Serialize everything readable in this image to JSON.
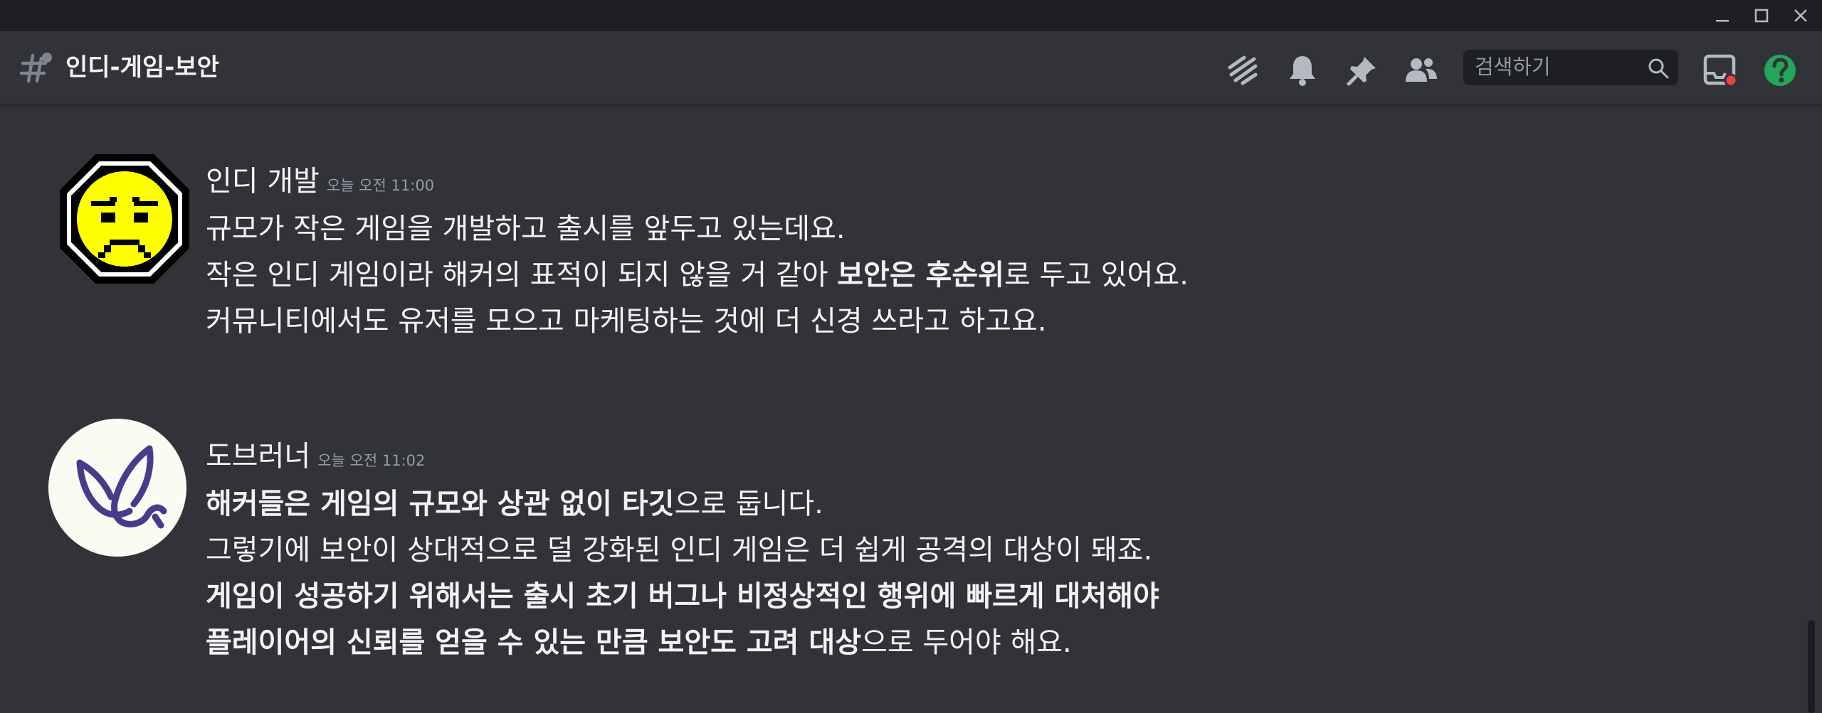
{
  "channel": {
    "name": "인디-게임-보안"
  },
  "search": {
    "placeholder": "검색하기"
  },
  "icons": {
    "hash": "hash-with-thread-icon",
    "threads": "threads-icon",
    "notifications": "bell-icon",
    "pins": "pin-icon",
    "members": "members-icon",
    "search": "search-icon",
    "inbox": "inbox-icon",
    "help": "help-icon"
  },
  "colors": {
    "background": "#313338",
    "titlebar": "#1e1f22",
    "help_green": "#23a55a",
    "inbox_badge": "#f23f43",
    "avatar1_yellow": "#ffff00",
    "avatar2_purple": "#4a3a8c"
  },
  "messages": [
    {
      "author": "인디 개발",
      "timestamp": "오늘 오전 11:00",
      "lines": [
        [
          {
            "text": "규모가 작은 게임을 개발하고 출시를 앞두고 있는데요.",
            "bold": false
          }
        ],
        [
          {
            "text": "작은 인디 게임이라 해커의 표적이 되지 않을 거 같아 ",
            "bold": false
          },
          {
            "text": "보안은 후순위",
            "bold": true
          },
          {
            "text": "로 두고 있어요.",
            "bold": false
          }
        ],
        [
          {
            "text": "커뮤니티에서도 유저를 모으고 마케팅하는 것에 더 신경 쓰라고 하고요.",
            "bold": false
          }
        ]
      ]
    },
    {
      "author": "도브러너",
      "timestamp": "오늘 오전 11:02",
      "lines": [
        [
          {
            "text": "해커들은 게임의 규모와 상관 없이 타깃",
            "bold": true
          },
          {
            "text": "으로 둡니다.",
            "bold": false
          }
        ],
        [
          {
            "text": "그렇기에 보안이 상대적으로 덜 강화된 인디 게임은 더 쉽게 공격의 대상이 돼죠.",
            "bold": false
          }
        ],
        [
          {
            "text": "게임이 성공하기 위해서는 출시 초기 버그나 비정상적인 행위에 빠르게 대처해야",
            "bold": true
          }
        ],
        [
          {
            "text": "플레이어의 신뢰를 얻을 수 있는 만큼 보안도 고려 대상",
            "bold": true
          },
          {
            "text": "으로 두어야 해요.",
            "bold": false
          }
        ]
      ]
    }
  ]
}
